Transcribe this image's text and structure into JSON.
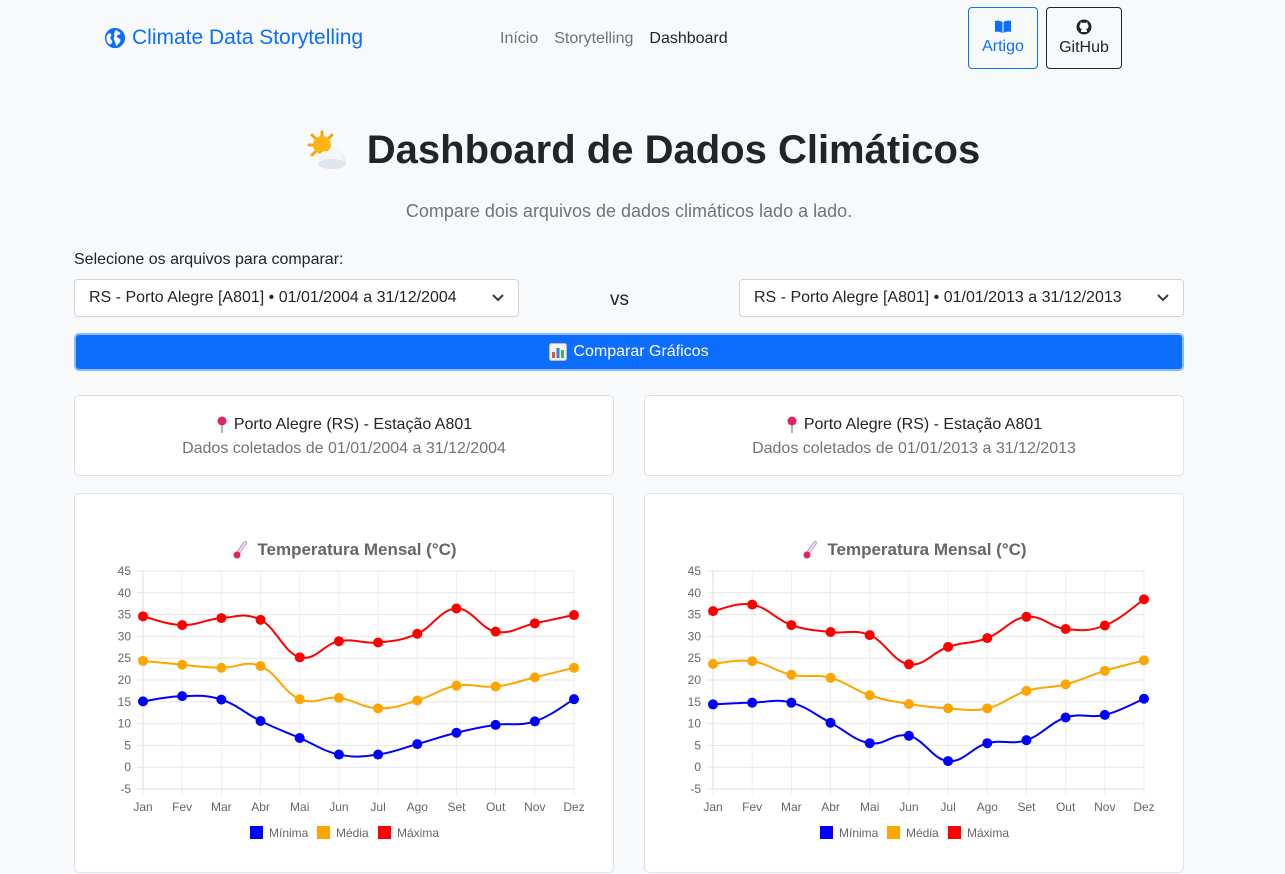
{
  "navbar": {
    "brand": "Climate Data Storytelling",
    "links": [
      {
        "label": "Início",
        "active": false
      },
      {
        "label": "Storytelling",
        "active": false
      },
      {
        "label": "Dashboard",
        "active": true
      }
    ],
    "artigo_label": "Artigo",
    "github_label": "GitHub"
  },
  "page": {
    "title": "Dashboard de Dados Climáticos",
    "subtitle": "Compare dois arquivos de dados climáticos lado a lado.",
    "select_label": "Selecione os arquivos para comparar:",
    "vs": "vs",
    "compare_button": "Comparar Gráficos"
  },
  "selects": {
    "left": "RS - Porto Alegre [A801] • 01/01/2004 a 31/12/2004",
    "right": "RS - Porto Alegre [A801] • 01/01/2013 a 31/12/2013"
  },
  "info": {
    "left": {
      "location": "Porto Alegre (RS) - Estação A801",
      "dates": "Dados coletados de 01/01/2004 a 31/12/2004"
    },
    "right": {
      "location": "Porto Alegre (RS) - Estação A801",
      "dates": "Dados coletados de 01/01/2013 a 31/12/2013"
    }
  },
  "colors": {
    "primary": "#0d6efd",
    "minima": "#0000ff",
    "media": "#ffa500",
    "maxima": "#ff0000"
  },
  "chart_data": [
    {
      "type": "line",
      "title": "Temperatura Mensal (°C)",
      "categories": [
        "Jan",
        "Fev",
        "Mar",
        "Abr",
        "Mai",
        "Jun",
        "Jul",
        "Ago",
        "Set",
        "Out",
        "Nov",
        "Dez"
      ],
      "ylim": [
        -5,
        45
      ],
      "yticks": [
        -5,
        0,
        5,
        10,
        15,
        20,
        25,
        30,
        35,
        40,
        45
      ],
      "legend": "bottom",
      "series": [
        {
          "name": "Mínima",
          "color": "#0000ff",
          "values": [
            15.1,
            16.3,
            15.5,
            10.6,
            6.7,
            2.9,
            2.9,
            5.3,
            7.9,
            9.7,
            10.5,
            15.6
          ]
        },
        {
          "name": "Média",
          "color": "#ffa500",
          "values": [
            24.4,
            23.5,
            22.8,
            23.2,
            15.6,
            15.9,
            13.5,
            15.3,
            18.7,
            18.5,
            20.6,
            22.8
          ]
        },
        {
          "name": "Máxima",
          "color": "#ff0000",
          "values": [
            34.6,
            32.6,
            34.2,
            33.8,
            25.2,
            28.9,
            28.6,
            30.6,
            36.4,
            31.1,
            33.0,
            34.9
          ]
        }
      ]
    },
    {
      "type": "line",
      "title": "Temperatura Mensal (°C)",
      "categories": [
        "Jan",
        "Fev",
        "Mar",
        "Abr",
        "Mai",
        "Jun",
        "Jul",
        "Ago",
        "Set",
        "Out",
        "Nov",
        "Dez"
      ],
      "ylim": [
        -5,
        45
      ],
      "yticks": [
        -5,
        0,
        5,
        10,
        15,
        20,
        25,
        30,
        35,
        40,
        45
      ],
      "legend": "bottom",
      "series": [
        {
          "name": "Mínima",
          "color": "#0000ff",
          "values": [
            14.4,
            14.8,
            14.8,
            10.2,
            5.5,
            7.2,
            1.4,
            5.5,
            6.2,
            11.4,
            12.0,
            15.7
          ]
        },
        {
          "name": "Média",
          "color": "#ffa500",
          "values": [
            23.7,
            24.3,
            21.2,
            20.5,
            16.5,
            14.5,
            13.5,
            13.5,
            17.5,
            19.0,
            22.1,
            24.5
          ]
        },
        {
          "name": "Máxima",
          "color": "#ff0000",
          "values": [
            35.8,
            37.3,
            32.6,
            31.0,
            30.3,
            23.6,
            27.6,
            29.6,
            34.5,
            31.7,
            32.5,
            38.5
          ]
        }
      ]
    }
  ]
}
